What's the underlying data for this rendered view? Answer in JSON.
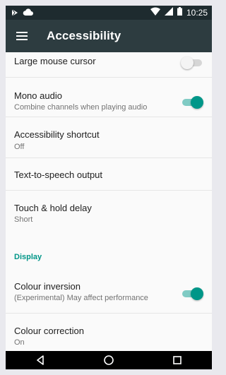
{
  "status_bar": {
    "time": "10:25",
    "icons": [
      "play-store-icon",
      "cloud-icon",
      "wifi-icon",
      "signal-icon",
      "battery-icon"
    ]
  },
  "app_bar": {
    "title": "Accessibility",
    "menu_icon": "menu-icon"
  },
  "settings": [
    {
      "title": "Large mouse cursor",
      "subtitle": "",
      "toggle": "off"
    },
    {
      "title": "Mono audio",
      "subtitle": "Combine channels when playing audio",
      "toggle": "on"
    },
    {
      "title": "Accessibility shortcut",
      "subtitle": "Off"
    },
    {
      "title": "Text-to-speech output",
      "subtitle": ""
    },
    {
      "title": "Touch & hold delay",
      "subtitle": "Short"
    }
  ],
  "display_section": {
    "header": "Display",
    "items": [
      {
        "title": "Colour inversion",
        "subtitle": "(Experimental) May affect performance",
        "toggle": "on"
      },
      {
        "title": "Colour correction",
        "subtitle": "On"
      }
    ]
  },
  "nav_bar": {
    "icons": [
      "back-icon",
      "home-icon",
      "recents-icon"
    ]
  },
  "colors": {
    "accent": "#009688",
    "app_bar": "#2d3c40",
    "status_bar": "#1e2b2f"
  }
}
